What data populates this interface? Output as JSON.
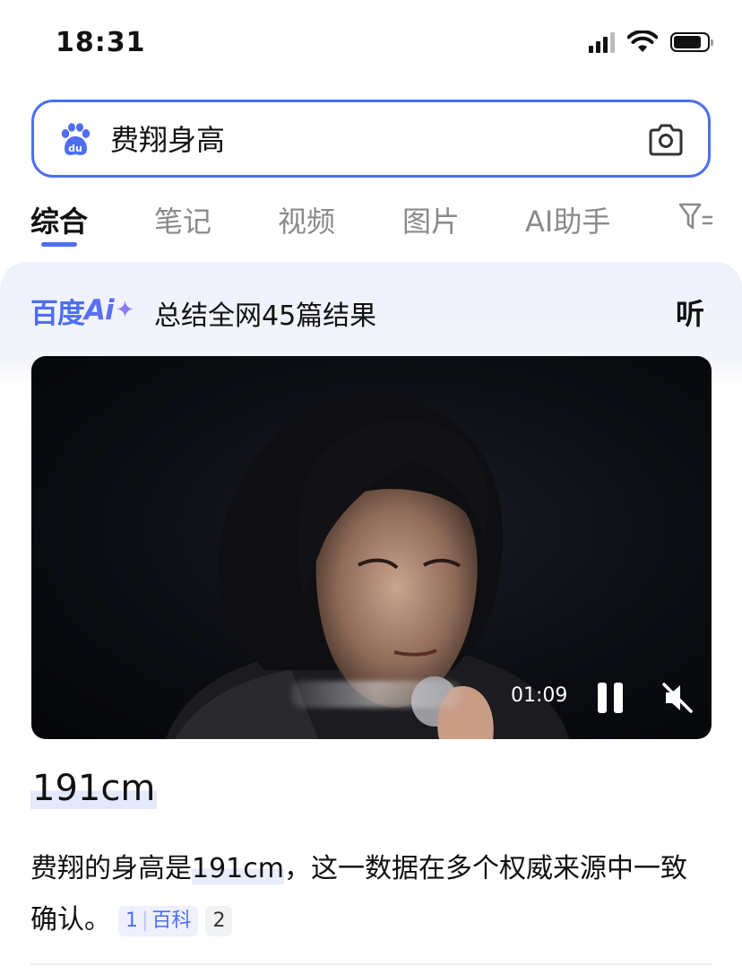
{
  "status_bar": {
    "time": "18:31"
  },
  "search": {
    "query": "费翔身高",
    "camera_icon": "camera-icon",
    "logo_icon": "baidu-paw-icon"
  },
  "tabs": [
    {
      "label": "综合",
      "active": true
    },
    {
      "label": "笔记",
      "active": false
    },
    {
      "label": "视频",
      "active": false
    },
    {
      "label": "图片",
      "active": false
    },
    {
      "label": "AI助手",
      "active": false
    }
  ],
  "ai_panel": {
    "logo_text": "百度",
    "logo_ai": "Ai",
    "summary": "总结全网45篇结果",
    "listen_label": "听"
  },
  "video": {
    "time": "01:09",
    "playing": true,
    "muted": true
  },
  "result": {
    "title": "191cm",
    "body_prefix": "费翔的身高是",
    "body_highlight": "191cm",
    "body_suffix": "，这一数据在多个权威来源中一致确认。",
    "citations": [
      {
        "number": "1",
        "source": "百科"
      },
      {
        "number": "2",
        "source": ""
      }
    ]
  },
  "colors": {
    "accent": "#4e6ef2",
    "text": "#111111",
    "muted": "#8a8a8a"
  }
}
